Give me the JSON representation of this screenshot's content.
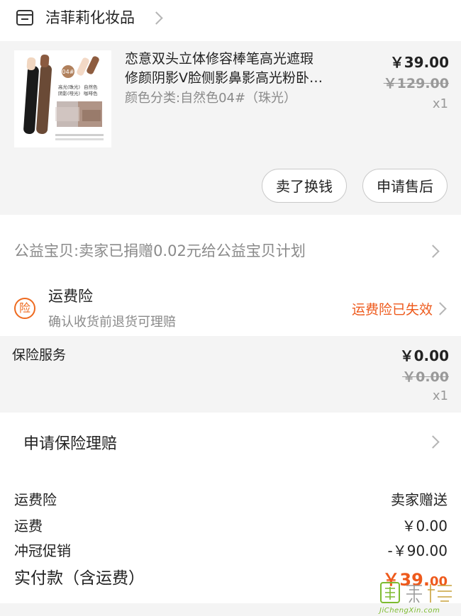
{
  "shop": {
    "name": "洁菲莉化妆品",
    "icon": "store-icon"
  },
  "product": {
    "title_line1": "恋意双头立体修容棒笔高光遮瑕",
    "title_line2": "修颜阴影V脸侧影鼻影高光粉卧…",
    "spec": "颜色分类:自然色04#（珠光）",
    "price": "￥39.00",
    "original_price": "￥129.00",
    "quantity": "x1",
    "thumb_badge": "04#",
    "thumb_lines": [
      "高光(珠光)",
      "自然色",
      "阴影(哑光)",
      "咖啡色"
    ],
    "sell_button": "卖了换钱",
    "after_sale_button": "申请售后"
  },
  "charity": {
    "text": "公益宝贝:卖家已捐赠0.02元给公益宝贝计划"
  },
  "freight_insurance": {
    "badge": "险",
    "title": "运费险",
    "subtitle": "确认收货前退货可理赔",
    "status": "运费险已失效"
  },
  "insurance_service": {
    "name": "保险服务",
    "price": "￥0.00",
    "original_price": "￥0.00",
    "quantity": "x1"
  },
  "claim": {
    "text": "申请保险理赔"
  },
  "summary": {
    "rows": [
      {
        "label": "运费险",
        "value": "卖家赠送"
      },
      {
        "label": "运费",
        "value": "￥0.00"
      },
      {
        "label": "冲冠促销",
        "value": "-￥90.00"
      }
    ],
    "total_label": "实付款（含运费）",
    "total_big": "￥39.",
    "total_small": "00"
  },
  "watermark": {
    "text": "JiChengXin.com"
  },
  "colors": {
    "accent": "#ee5a1c",
    "muted": "#8a8a8a",
    "section_bg": "#f4f4f4"
  }
}
